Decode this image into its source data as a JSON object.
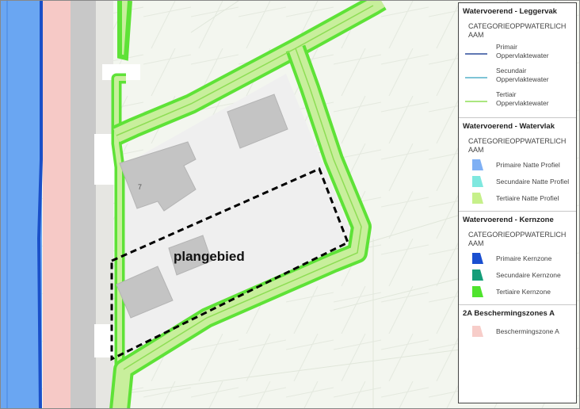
{
  "map": {
    "plan_label": "plangebied",
    "house_number": "7",
    "colors": {
      "background": "#f3f6ef",
      "primary_water": "#6aa6f2",
      "primary_kernzone": "#1a4fc8",
      "tertiary_green": "#5ee237",
      "tertiary_fill": "#c8ef9c",
      "protection_zone": "#f6c9c6",
      "road": "#c8c8c8",
      "parcel": "#efefef",
      "building": "#c4c4c4",
      "boundary": "#000000"
    }
  },
  "legend": {
    "sections": [
      {
        "title": "Watervoerend - Leggervak",
        "field": "CATEGORIEOPPWATERLICH\nAAM",
        "items": [
          {
            "label": "Primair\nOppervlaktewater",
            "symbol": "line",
            "color": "#2b4b9a"
          },
          {
            "label": "Secundair\nOppervlaktewater",
            "symbol": "line",
            "color": "#55b0c8"
          },
          {
            "label": "Tertiair\nOppervlaktewater",
            "symbol": "line",
            "color": "#8edd55"
          }
        ]
      },
      {
        "title": "Watervoerend - Watervlak",
        "field": "CATEGORIEOPPWATERLICH\nAAM",
        "items": [
          {
            "label": "Primaire Natte Profiel",
            "symbol": "poly",
            "color": "#7fb0f4"
          },
          {
            "label": "Secundaire Natte Profiel",
            "symbol": "poly",
            "color": "#7fe8df"
          },
          {
            "label": "Tertiaire Natte Profiel",
            "symbol": "poly",
            "color": "#c6f08a"
          }
        ]
      },
      {
        "title": "Watervoerend - Kernzone",
        "field": "CATEGORIEOPPWATERLICH\nAAM",
        "items": [
          {
            "label": "Primaire Kernzone",
            "symbol": "poly",
            "color": "#1a4fd0"
          },
          {
            "label": "Secundaire Kernzone",
            "symbol": "poly",
            "color": "#159d79"
          },
          {
            "label": "Tertiaire Kernzone",
            "symbol": "poly",
            "color": "#4fe32d"
          }
        ]
      },
      {
        "title": "2A Beschermingszones A",
        "field": "",
        "items": [
          {
            "label": "Beschermingszone A",
            "symbol": "poly",
            "color": "#f7cdc9"
          }
        ]
      }
    ]
  }
}
